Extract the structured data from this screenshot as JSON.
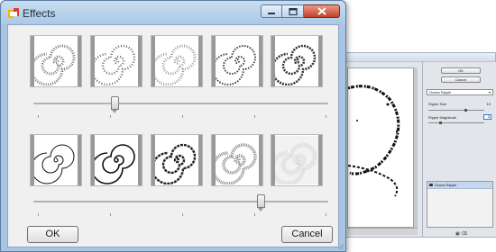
{
  "dialog": {
    "title": "Effects",
    "ok_label": "OK",
    "cancel_label": "Cancel",
    "top_slider_fraction": 0.27,
    "bottom_slider_fraction": 0.78
  },
  "background_app": {
    "ok_label": "OK",
    "cancel_label": "Cancel",
    "filter_select_value": "Ocean Ripple",
    "param1_label": "Ripple Size",
    "param1_value": "10",
    "param2_label": "Ripple Magnitude",
    "param2_value": "3",
    "layer_name": "Ocean Ripple"
  },
  "icons": {
    "app": "app-icon",
    "minimize": "minimize-icon",
    "maximize": "maximize-icon",
    "close": "close-icon",
    "resize_grip": "resize-grip-icon"
  },
  "colors": {
    "title_bar": "#aac8e6",
    "close_button": "#c3402a",
    "client": "#f0f0f0"
  }
}
